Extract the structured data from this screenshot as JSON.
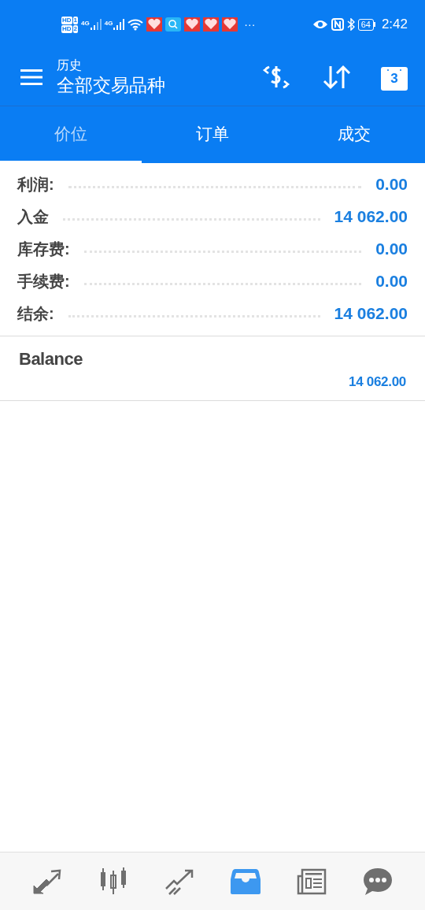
{
  "status_bar": {
    "sims": [
      {
        "hd": "HD",
        "slot": "1",
        "network": "4G"
      },
      {
        "hd": "HD",
        "slot": "2",
        "network": "4G"
      }
    ],
    "more": "···",
    "battery": "64",
    "time": "2:42"
  },
  "header": {
    "subtitle": "历史",
    "title": "全部交易品种",
    "calendar_day": "3"
  },
  "tabs": [
    {
      "label": "价位",
      "selected": true
    },
    {
      "label": "订单",
      "selected": false
    },
    {
      "label": "成交",
      "selected": false
    }
  ],
  "summary": [
    {
      "label": "利润:",
      "value": "0.00"
    },
    {
      "label": "入金",
      "value": "14 062.00"
    },
    {
      "label": "库存费:",
      "value": "0.00"
    },
    {
      "label": "手续费:",
      "value": "0.00"
    },
    {
      "label": "结余:",
      "value": "14 062.00"
    }
  ],
  "deals": [
    {
      "type": "Balance",
      "amount": "14 062.00"
    }
  ],
  "bottom_nav": [
    {
      "kind": "trade",
      "selected": false
    },
    {
      "kind": "chart",
      "selected": false
    },
    {
      "kind": "trend",
      "selected": false
    },
    {
      "kind": "history",
      "selected": true
    },
    {
      "kind": "news",
      "selected": false
    },
    {
      "kind": "chat",
      "selected": false
    }
  ]
}
